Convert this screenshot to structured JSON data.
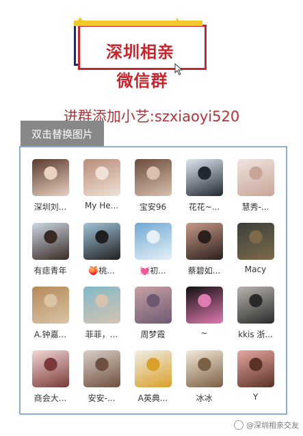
{
  "banner": {
    "title_line1": "深圳相亲",
    "title_line2": "微信群"
  },
  "contact_text": "进群添加小艺:szxiaoyi520",
  "replace_button_label": "双击替换图片",
  "members": [
    {
      "name": "深圳刘...",
      "colors": [
        "#5a3a2e",
        "#e8d2c2"
      ]
    },
    {
      "name": "My He...",
      "colors": [
        "#b88c79",
        "#f0e1d6"
      ]
    },
    {
      "name": "宝安96",
      "colors": [
        "#6b4a3c",
        "#d9c1b0"
      ]
    },
    {
      "name": "花花~...",
      "colors": [
        "#dfe8f2",
        "#222831"
      ]
    },
    {
      "name": "慧秀-...",
      "colors": [
        "#efe5e0",
        "#c9a598"
      ]
    },
    {
      "name": "有痣青年",
      "colors": [
        "#cdd8e6",
        "#3a2a24"
      ]
    },
    {
      "name": "🍑桃...",
      "colors": [
        "#9fc4da",
        "#1f1f1f"
      ]
    },
    {
      "name": "💓初...",
      "colors": [
        "#6fa9d4",
        "#e6f0f7"
      ]
    },
    {
      "name": "蔡碧如...",
      "colors": [
        "#c79a89",
        "#2b1f1b"
      ]
    },
    {
      "name": "Macy",
      "colors": [
        "#3a3f3b",
        "#7d6a4a"
      ]
    },
    {
      "name": "A.钟嘉...",
      "colors": [
        "#b68a5a",
        "#d8c4a4"
      ]
    },
    {
      "name": "菲菲，...",
      "colors": [
        "#7fb9c8",
        "#d6c4b0"
      ]
    },
    {
      "name": "周梦霞",
      "colors": [
        "#c8a0a4",
        "#6d5a72"
      ]
    },
    {
      "name": "~",
      "colors": [
        "#111111",
        "#e07ab0"
      ]
    },
    {
      "name": "kkis 浙...",
      "colors": [
        "#b9b5ad",
        "#2a2a2a"
      ]
    },
    {
      "name": "商会大...",
      "colors": [
        "#f2d7d5",
        "#7b3a3a"
      ]
    },
    {
      "name": "安安-...",
      "colors": [
        "#d9cfc7",
        "#6f4f3f"
      ]
    },
    {
      "name": "A英典...",
      "colors": [
        "#f0ede6",
        "#d9a02a"
      ]
    },
    {
      "name": "冰冰",
      "colors": [
        "#f3ead9",
        "#7a6044"
      ]
    },
    {
      "name": "Y",
      "colors": [
        "#e8a7a0",
        "#5a3228"
      ]
    }
  ],
  "watermark": "@深圳相亲交友"
}
